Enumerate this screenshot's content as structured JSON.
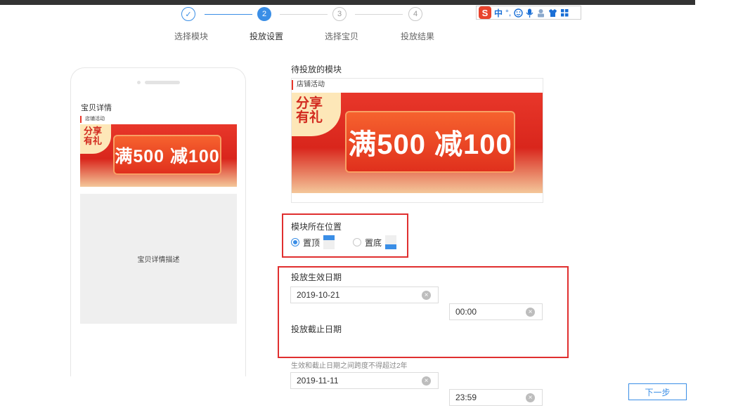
{
  "steps": [
    {
      "number": "✓",
      "label": "选择模块",
      "state": "done"
    },
    {
      "number": "2",
      "label": "投放设置",
      "state": "active"
    },
    {
      "number": "3",
      "label": "选择宝贝",
      "state": "todo"
    },
    {
      "number": "4",
      "label": "投放结果",
      "state": "todo"
    }
  ],
  "ime_toolbar": {
    "logo": "S",
    "mode": "中",
    "punct": "°,",
    "icons": [
      "smiley-icon",
      "microphone-icon",
      "keyboard-icon",
      "shirt-icon",
      "grid-icon"
    ]
  },
  "preview": {
    "title": "宝贝详情",
    "tag": "店铺活动",
    "banner_corner": "分享\n有礼",
    "banner_main": "满500 减100",
    "description": "宝贝详情描述"
  },
  "module": {
    "section_title": "待投放的模块",
    "tag": "店铺活动",
    "banner_corner": "分享\n有礼",
    "banner_main": "满500 减100"
  },
  "position": {
    "label": "模块所在位置",
    "options": [
      {
        "label": "置顶",
        "selected": true
      },
      {
        "label": "置底",
        "selected": false
      }
    ]
  },
  "start": {
    "label": "投放生效日期",
    "date": "2019-10-21",
    "time": "00:00"
  },
  "end": {
    "label": "投放截止日期",
    "date": "2019-11-11",
    "time": "23:59"
  },
  "hint": "生效和截止日期之间跨度不得超过2年",
  "next_button": "下一步",
  "colors": {
    "accent": "#3a8ee6",
    "highlight": "#e02f2f",
    "banner_red": "#e8372a"
  }
}
